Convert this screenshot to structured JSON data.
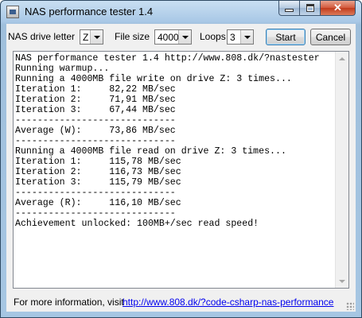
{
  "window": {
    "title": "NAS performance tester 1.4"
  },
  "controls": {
    "drive_label": "NAS drive letter",
    "drive_value": "Z",
    "filesize_label": "File size",
    "filesize_value": "4000",
    "loops_label": "Loops",
    "loops_value": "3",
    "start_label": "Start",
    "cancel_label": "Cancel"
  },
  "log": [
    "NAS performance tester 1.4 http://www.808.dk/?nastester",
    "Running warmup...",
    "Running a 4000MB file write on drive Z: 3 times...",
    "Iteration 1:     82,22 MB/sec",
    "Iteration 2:     71,91 MB/sec",
    "Iteration 3:     67,44 MB/sec",
    "-----------------------------",
    "Average (W):     73,86 MB/sec",
    "-----------------------------",
    "Running a 4000MB file read on drive Z: 3 times...",
    "Iteration 1:     115,78 MB/sec",
    "Iteration 2:     116,73 MB/sec",
    "Iteration 3:     115,79 MB/sec",
    "-----------------------------",
    "Average (R):     116,10 MB/sec",
    "-----------------------------",
    "Achievement unlocked: 100MB+/sec read speed!"
  ],
  "footer": {
    "info_text": "For more information, visit",
    "link_text": "http://www.808.dk/?code-csharp-nas-performance"
  },
  "icons": [
    "app-icon",
    "minimize-icon",
    "maximize-icon",
    "close-icon",
    "dropdown-arrow-icon",
    "scroll-up-icon",
    "scroll-down-icon",
    "size-grip-icon"
  ]
}
